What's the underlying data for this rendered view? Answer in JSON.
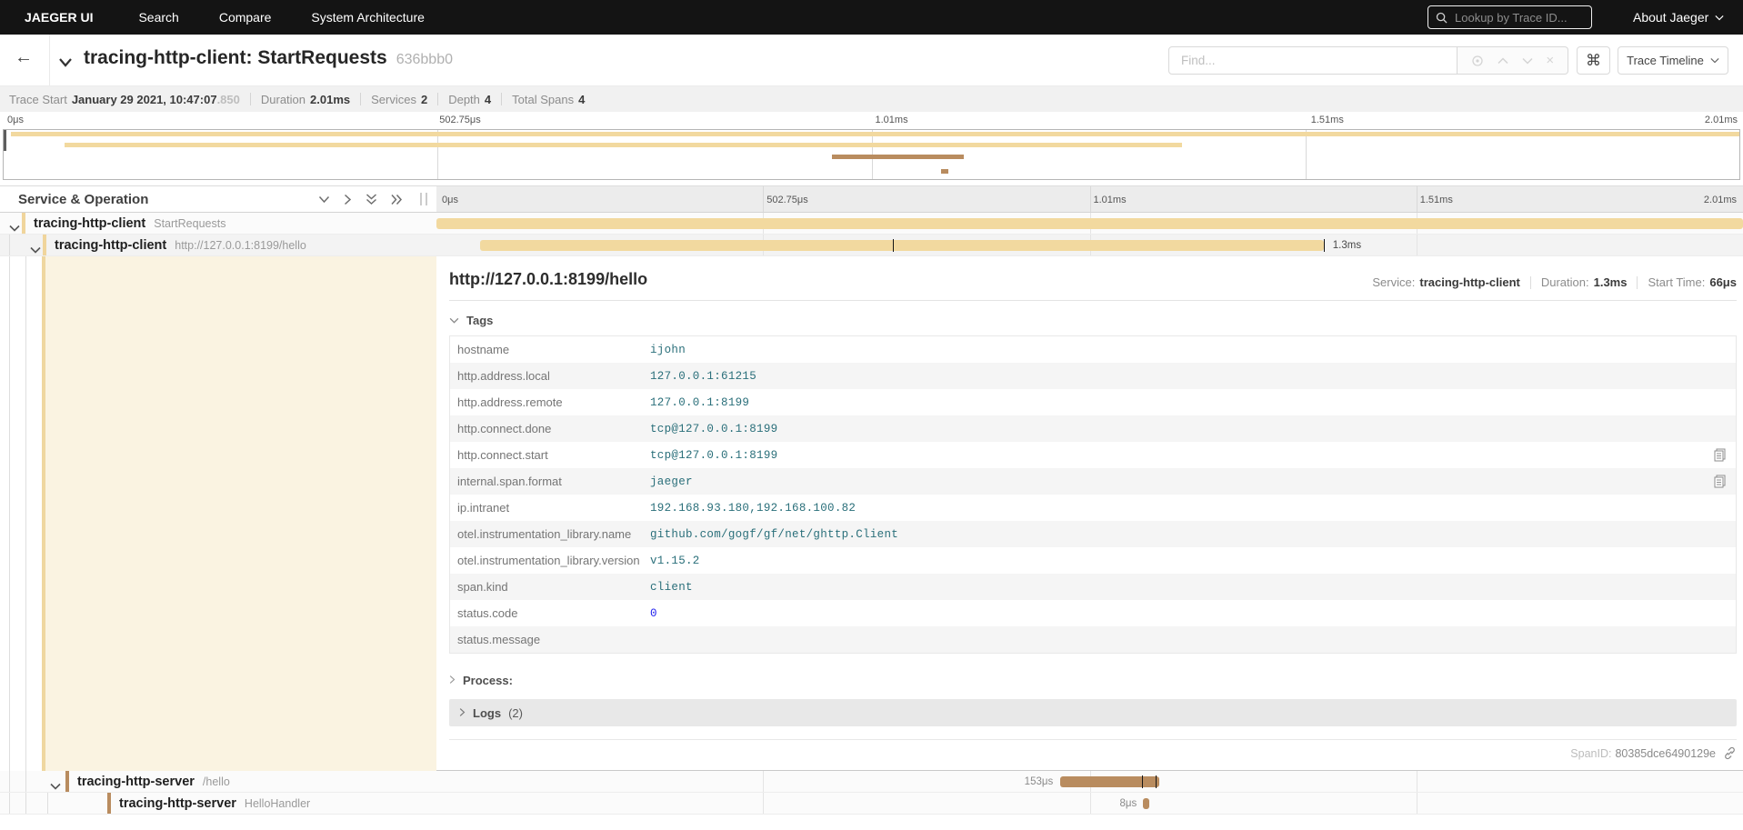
{
  "nav": {
    "brand": "JAEGER UI",
    "items": [
      "Search",
      "Compare",
      "System Architecture"
    ],
    "lookup_placeholder": "Lookup by Trace ID...",
    "about": "About Jaeger"
  },
  "header": {
    "title": "tracing-http-client: StartRequests",
    "trace_id_short": "636bbb0",
    "find_placeholder": "Find...",
    "view_select": "Trace Timeline"
  },
  "summary": {
    "trace_start_label": "Trace Start",
    "trace_start": "January 29 2021, 10:47:07",
    "trace_start_frac": ".850",
    "duration_label": "Duration",
    "duration": "2.01ms",
    "services_label": "Services",
    "services": "2",
    "depth_label": "Depth",
    "depth": "4",
    "total_spans_label": "Total Spans",
    "total_spans": "4"
  },
  "timeline": {
    "header_left": "Service & Operation",
    "ticks": [
      "0μs",
      "502.75μs",
      "1.01ms",
      "1.51ms",
      "2.01ms"
    ]
  },
  "colors": {
    "client_span": "#f2d99f",
    "server_span": "#b98c5f"
  },
  "spans": [
    {
      "service": "tracing-http-client",
      "operation": "StartRequests"
    },
    {
      "service": "tracing-http-client",
      "operation": "http://127.0.0.1:8199/hello",
      "duration_label": "1.3ms"
    },
    {
      "service": "tracing-http-server",
      "operation": "/hello",
      "duration_label": "153μs"
    },
    {
      "service": "tracing-http-server",
      "operation": "HelloHandler",
      "duration_label": "8μs"
    }
  ],
  "geometry": {
    "mm_bar1": "left:0.4%;top:2px;width:99.6%;height:5px;background:#f2d99f",
    "mm_bar2": "left:3.5%;top:14px;width:64.4%;height:5px;background:#f2d99f",
    "mm_bar3": "left:47.7%;top:27px;width:7.6%;height:5px;background:#b98c5f",
    "mm_bar4": "left:54%;top:43px;width:0.45%;height:5px;background:#b98c5f",
    "bar_root": "left:0;width:100%;background:#f2d99f",
    "bar_client": "left:3.35%;width:64.6%;background:#f2d99f",
    "bar_server": "left:47.75%;width:7.6%;background:#b98c5f",
    "bar_handler": "left:54.1%;width:7px;background:#b98c5f",
    "log_tick_client_1": "left:34.9%",
    "log_tick_client_2": "left:67.9%",
    "log_tick_server_1": "left:54%",
    "log_tick_server_2": "left:55.05%",
    "dur_client": "left:68.6%",
    "dur_server": "left:47.2%",
    "dur_handler": "left:53.6%"
  },
  "detail": {
    "operation": "http://127.0.0.1:8199/hello",
    "service_label": "Service:",
    "service": "tracing-http-client",
    "duration_label": "Duration:",
    "duration": "1.3ms",
    "start_label": "Start Time:",
    "start": "66μs",
    "tags_label": "Tags",
    "tags": [
      {
        "key": "hostname",
        "value": "ijohn"
      },
      {
        "key": "http.address.local",
        "value": "127.0.0.1:61215"
      },
      {
        "key": "http.address.remote",
        "value": "127.0.0.1:8199"
      },
      {
        "key": "http.connect.done",
        "value": "tcp@127.0.0.1:8199"
      },
      {
        "key": "http.connect.start",
        "value": "tcp@127.0.0.1:8199"
      },
      {
        "key": "internal.span.format",
        "value": "jaeger"
      },
      {
        "key": "ip.intranet",
        "value": "192.168.93.180,192.168.100.82"
      },
      {
        "key": "otel.instrumentation_library.name",
        "value": "github.com/gogf/gf/net/ghttp.Client"
      },
      {
        "key": "otel.instrumentation_library.version",
        "value": "v1.15.2"
      },
      {
        "key": "span.kind",
        "value": "client"
      },
      {
        "key": "status.code",
        "value": "0"
      },
      {
        "key": "status.message",
        "value": ""
      }
    ],
    "process_label": "Process:",
    "logs_label": "Logs",
    "logs_count": "(2)",
    "spanid_label": "SpanID:",
    "spanid": "80385dce6490129e"
  }
}
